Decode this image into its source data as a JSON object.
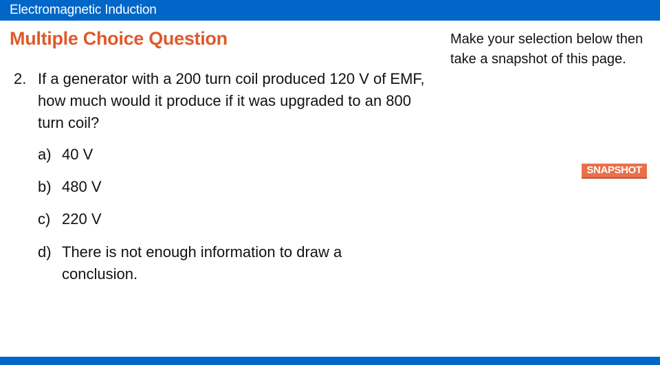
{
  "header": {
    "title": "Electromagnetic Induction"
  },
  "page": {
    "heading": "Multiple Choice Question"
  },
  "question": {
    "number": "2.",
    "text": "If a generator with a 200 turn coil produced 120 V of EMF, how much would it produce if it was upgraded to an 800 turn coil?"
  },
  "options": [
    {
      "letter": "a)",
      "text": "40 V"
    },
    {
      "letter": "b)",
      "text": "480 V"
    },
    {
      "letter": "c)",
      "text": "220 V"
    },
    {
      "letter": "d)",
      "text": "There is not enough information to draw a conclusion."
    }
  ],
  "sidebar": {
    "instructions": "Make your selection below then take a snapshot of this page.",
    "snapshot_label": "SNAPSHOT"
  },
  "colors": {
    "brand_blue": "#0066c8",
    "accent_orange": "#e0592a",
    "button_orange": "#e8704a"
  }
}
